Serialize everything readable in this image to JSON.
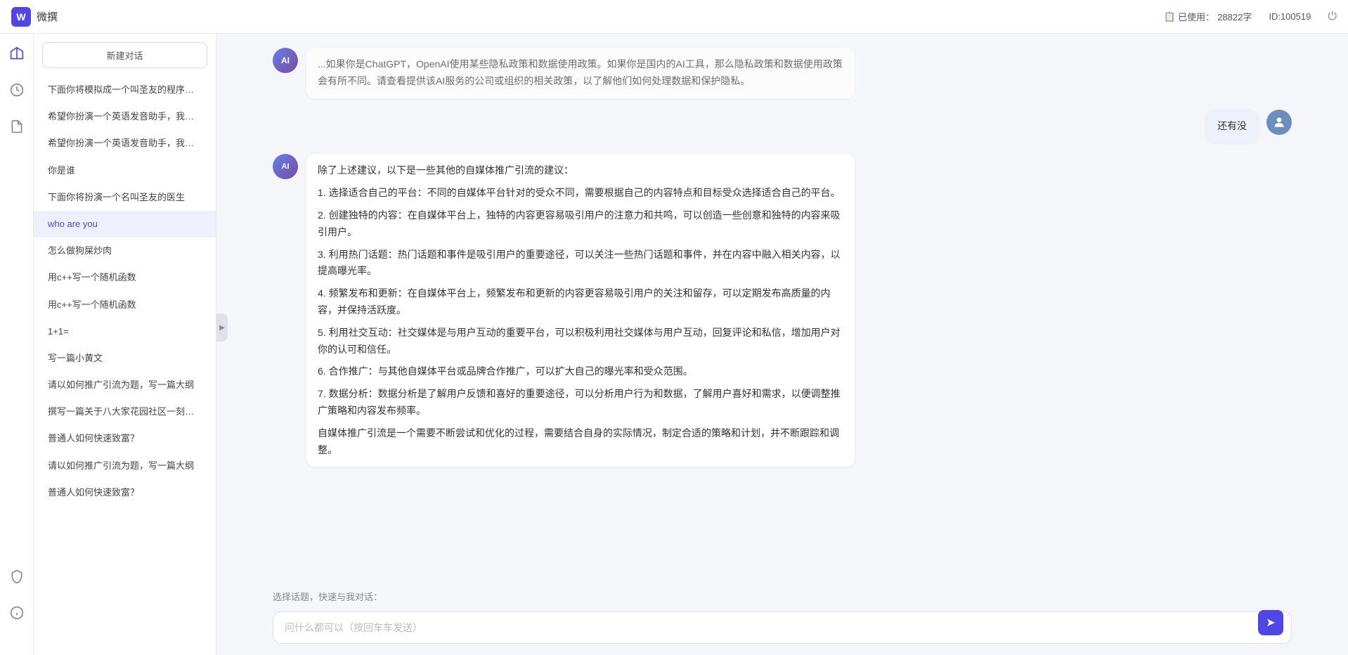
{
  "topbar": {
    "title": "微撰",
    "logo_text": "W",
    "usage_label": "已使用：",
    "usage_value": "28822字",
    "id_label": "ID:100519",
    "power_icon": "⏻"
  },
  "sidebar": {
    "new_btn_label": "新建对话",
    "items": [
      {
        "id": "item-1",
        "label": "下面你将模拟成一个叫圣友的程序员，我说..."
      },
      {
        "id": "item-2",
        "label": "希望你扮演一个英语发音助手，我提供给你..."
      },
      {
        "id": "item-3",
        "label": "希望你扮演一个英语发音助手，我提供给你..."
      },
      {
        "id": "item-4",
        "label": "你是谁"
      },
      {
        "id": "item-5",
        "label": "下面你将扮演一个名叫圣友的医生"
      },
      {
        "id": "item-6",
        "label": "who are you",
        "active": true
      },
      {
        "id": "item-7",
        "label": "怎么做狗屎炒肉"
      },
      {
        "id": "item-8",
        "label": "用c++写一个随机函数"
      },
      {
        "id": "item-9",
        "label": "用c++写一个随机函数"
      },
      {
        "id": "item-10",
        "label": "1+1="
      },
      {
        "id": "item-11",
        "label": "写一篇小黄文"
      },
      {
        "id": "item-12",
        "label": "请以如何推广引流为题，写一篇大纲"
      },
      {
        "id": "item-13",
        "label": "撰写一篇关于八大家花园社区一刻钟便民生..."
      },
      {
        "id": "item-14",
        "label": "普通人如何快速致富？"
      },
      {
        "id": "item-15",
        "label": "请以如何推广引流为题，写一篇大纲"
      },
      {
        "id": "item-16",
        "label": "普通人如何快速致富？"
      }
    ]
  },
  "icon_nav": {
    "items": [
      {
        "id": "nav-home",
        "icon": "⬡",
        "label": "home"
      },
      {
        "id": "nav-time",
        "icon": "⏱",
        "label": "history"
      },
      {
        "id": "nav-doc",
        "icon": "📄",
        "label": "document"
      }
    ],
    "bottom_items": [
      {
        "id": "nav-shield",
        "icon": "🛡",
        "label": "security"
      },
      {
        "id": "nav-info",
        "icon": "ℹ",
        "label": "info"
      },
      {
        "id": "nav-user",
        "icon": "👤",
        "label": "user"
      }
    ]
  },
  "chat": {
    "prev_message_partial": "...如果你是ChatGPT，OpenAI使用某些隐私政策和数据使用政策。如果你是国内的AI工具，那么隐私政策和数据使用政策会有所不同。请查看提供该AI服务的公司或组织的相关政策，以了解他们如何处理数据和保护隐私。",
    "messages": [
      {
        "id": "msg-user-1",
        "type": "user",
        "text": "还有没"
      },
      {
        "id": "msg-ai-1",
        "type": "ai",
        "paragraphs": [
          "除了上述建议，以下是一些其他的自媒体推广引流的建议：",
          "1. 选择适合自己的平台：不同的自媒体平台针对的受众不同，需要根据自己的内容特点和目标受众选择适合自己的平台。",
          "2. 创建独特的内容：在自媒体平台上，独特的内容更容易吸引用户的注意力和共鸣，可以创造一些创意和独特的内容来吸引用户。",
          "3. 利用热门话题：热门话题和事件是吸引用户的重要途径，可以关注一些热门话题和事件，并在内容中融入相关内容，以提高曝光率。",
          "4. 频繁发布和更新：在自媒体平台上，频繁发布和更新的内容更容易吸引用户的关注和留存，可以定期发布高质量的内容，并保持活跃度。",
          "5. 利用社交互动：社交媒体是与用户互动的重要平台，可以积极利用社交媒体与用户互动，回复评论和私信，增加用户对你的认可和信任。",
          "6. 合作推广：与其他自媒体平台或品牌合作推广，可以扩大自己的曝光率和受众范围。",
          "7. 数据分析：数据分析是了解用户反馈和喜好的重要途径，可以分析用户行为和数据，了解用户喜好和需求，以便调整推广策略和内容发布频率。",
          "自媒体推广引流是一个需要不断尝试和优化的过程，需要结合自身的实际情况，制定合适的策略和计划，并不断跟踪和调整。"
        ]
      }
    ],
    "quick_topics_label": "选择话题，快速与我对话：",
    "input_placeholder": "问什么都可以（按回车车发送）",
    "send_icon": "➤"
  }
}
